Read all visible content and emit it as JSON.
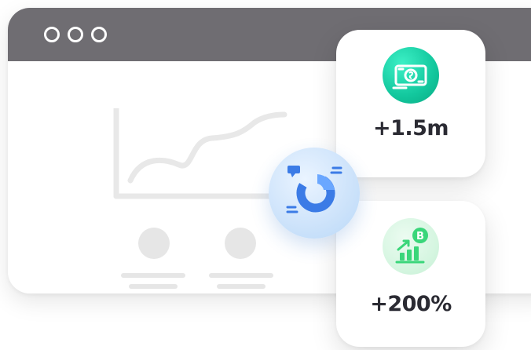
{
  "window": {
    "titlebar_color": "#6f6d72",
    "controls": [
      "circle-button",
      "circle-button",
      "circle-button"
    ]
  },
  "cards": [
    {
      "icon": "money-icon",
      "value": "+1.5m",
      "accent": "#14c9a0"
    },
    {
      "icon": "crypto-growth-icon",
      "value": "+200%",
      "accent": "#3ad67a"
    }
  ],
  "badge": {
    "icon": "pie-chart-icon",
    "accent": "#2f7de1"
  }
}
